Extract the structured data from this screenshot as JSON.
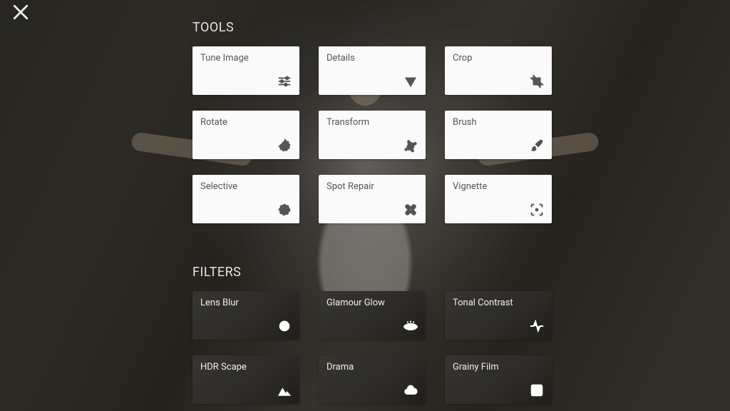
{
  "sections": {
    "tools_title": "TOOLS",
    "filters_title": "FILTERS"
  },
  "tools": [
    {
      "label": "Tune Image",
      "icon": "sliders-icon"
    },
    {
      "label": "Details",
      "icon": "triangle-down-icon"
    },
    {
      "label": "Crop",
      "icon": "crop-icon"
    },
    {
      "label": "Rotate",
      "icon": "rotate-icon"
    },
    {
      "label": "Transform",
      "icon": "transform-icon"
    },
    {
      "label": "Brush",
      "icon": "brush-icon"
    },
    {
      "label": "Selective",
      "icon": "selective-icon"
    },
    {
      "label": "Spot Repair",
      "icon": "bandage-icon"
    },
    {
      "label": "Vignette",
      "icon": "vignette-icon"
    }
  ],
  "filters": [
    {
      "label": "Lens Blur",
      "icon": "target-icon"
    },
    {
      "label": "Glamour Glow",
      "icon": "eye-icon"
    },
    {
      "label": "Tonal Contrast",
      "icon": "pulse-icon"
    },
    {
      "label": "HDR Scape",
      "icon": "mountains-icon"
    },
    {
      "label": "Drama",
      "icon": "cloud-icon"
    },
    {
      "label": "Grainy Film",
      "icon": "dice-icon"
    }
  ]
}
